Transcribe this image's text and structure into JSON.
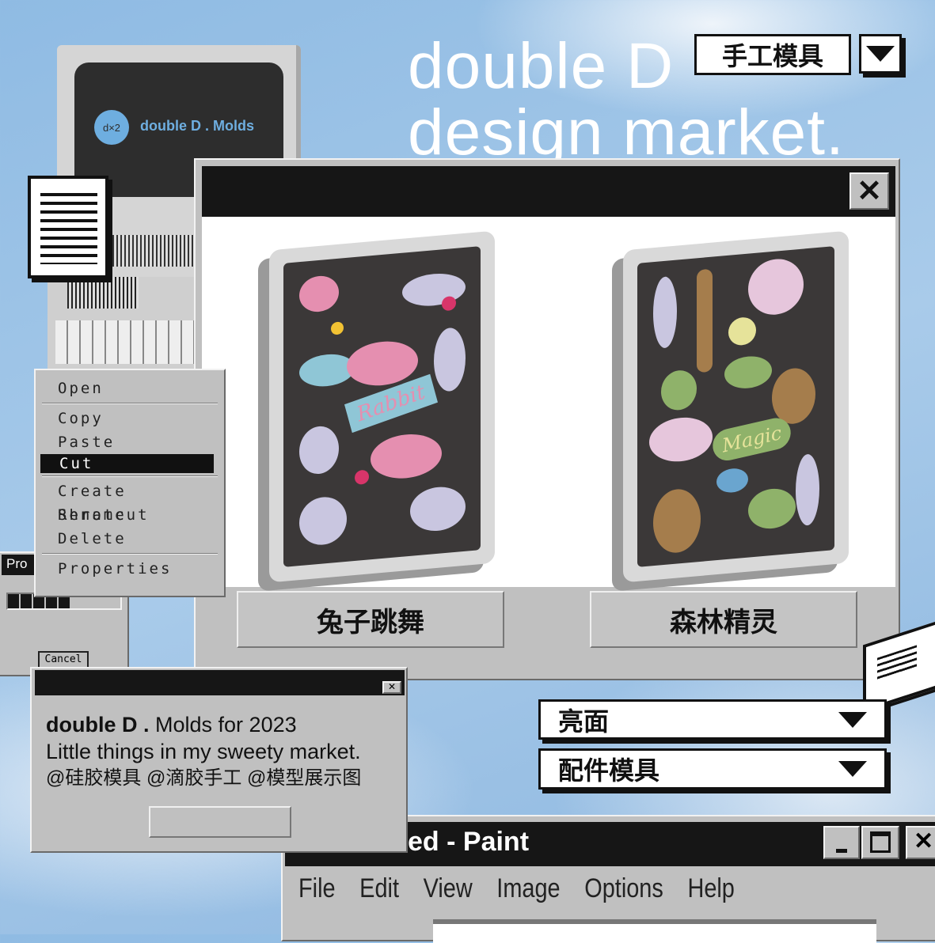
{
  "headline": {
    "line1": "double D",
    "line2": "design market."
  },
  "category_dropdown": {
    "value": "手工模具",
    "icon": "triangle-down-icon"
  },
  "monitor": {
    "logo_mark": "d×2",
    "logo_text": "double D . Molds"
  },
  "main_window": {
    "close_icon": "close-icon",
    "products": [
      {
        "name": "兔子跳舞",
        "artwork_text": "Rabbit",
        "colors": [
          "#e58fb0",
          "#c9c6e0",
          "#8fc6d6",
          "#d8356a",
          "#f2c233"
        ]
      },
      {
        "name": "森林精灵",
        "artwork_text": "Magic",
        "colors": [
          "#8fb26a",
          "#a57d4c",
          "#e6c6dc",
          "#6aa5cf",
          "#e6e39a"
        ]
      }
    ]
  },
  "context_menu": {
    "items": [
      {
        "label": "Open",
        "group": 1
      },
      {
        "label": "Copy",
        "group": 2
      },
      {
        "label": "Paste",
        "group": 2
      },
      {
        "label": "Cut",
        "group": 2,
        "selected": true
      },
      {
        "label": "Create Shrotcut",
        "group": 3
      },
      {
        "label": "Rename",
        "group": 3
      },
      {
        "label": "Delete",
        "group": 3
      },
      {
        "label": "Properties",
        "group": 4
      }
    ]
  },
  "progress_dialog": {
    "title": "Pro",
    "cancel_label": "Cancel",
    "progress_percent": 55
  },
  "info_dialog": {
    "brand": "double D .",
    "line1_rest": "Molds for 2023",
    "line2": "Little things in my sweety market.",
    "line3": "@硅胶模具 @滴胶手工 @模型展示图"
  },
  "finish_dropdown": {
    "value": "亮面"
  },
  "type_dropdown": {
    "value": "配件模具"
  },
  "paint_window": {
    "title": "ed - Paint",
    "menu": [
      "File",
      "Edit",
      "View",
      "Image",
      "Options",
      "Help"
    ]
  }
}
